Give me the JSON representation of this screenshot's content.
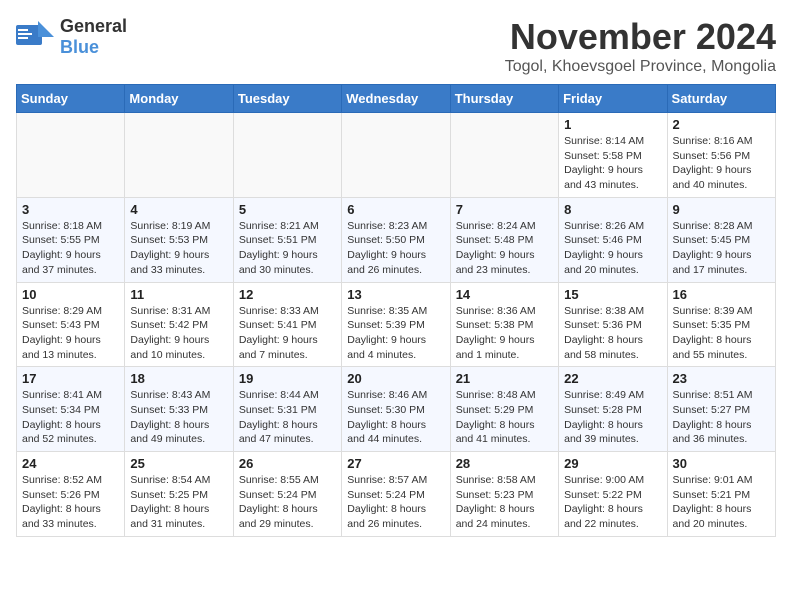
{
  "header": {
    "logo_general": "General",
    "logo_blue": "Blue",
    "month_title": "November 2024",
    "subtitle": "Togol, Khoevsgoel Province, Mongolia"
  },
  "weekdays": [
    "Sunday",
    "Monday",
    "Tuesday",
    "Wednesday",
    "Thursday",
    "Friday",
    "Saturday"
  ],
  "weeks": [
    [
      {
        "day": "",
        "info": ""
      },
      {
        "day": "",
        "info": ""
      },
      {
        "day": "",
        "info": ""
      },
      {
        "day": "",
        "info": ""
      },
      {
        "day": "",
        "info": ""
      },
      {
        "day": "1",
        "info": "Sunrise: 8:14 AM\nSunset: 5:58 PM\nDaylight: 9 hours\nand 43 minutes."
      },
      {
        "day": "2",
        "info": "Sunrise: 8:16 AM\nSunset: 5:56 PM\nDaylight: 9 hours\nand 40 minutes."
      }
    ],
    [
      {
        "day": "3",
        "info": "Sunrise: 8:18 AM\nSunset: 5:55 PM\nDaylight: 9 hours\nand 37 minutes."
      },
      {
        "day": "4",
        "info": "Sunrise: 8:19 AM\nSunset: 5:53 PM\nDaylight: 9 hours\nand 33 minutes."
      },
      {
        "day": "5",
        "info": "Sunrise: 8:21 AM\nSunset: 5:51 PM\nDaylight: 9 hours\nand 30 minutes."
      },
      {
        "day": "6",
        "info": "Sunrise: 8:23 AM\nSunset: 5:50 PM\nDaylight: 9 hours\nand 26 minutes."
      },
      {
        "day": "7",
        "info": "Sunrise: 8:24 AM\nSunset: 5:48 PM\nDaylight: 9 hours\nand 23 minutes."
      },
      {
        "day": "8",
        "info": "Sunrise: 8:26 AM\nSunset: 5:46 PM\nDaylight: 9 hours\nand 20 minutes."
      },
      {
        "day": "9",
        "info": "Sunrise: 8:28 AM\nSunset: 5:45 PM\nDaylight: 9 hours\nand 17 minutes."
      }
    ],
    [
      {
        "day": "10",
        "info": "Sunrise: 8:29 AM\nSunset: 5:43 PM\nDaylight: 9 hours\nand 13 minutes."
      },
      {
        "day": "11",
        "info": "Sunrise: 8:31 AM\nSunset: 5:42 PM\nDaylight: 9 hours\nand 10 minutes."
      },
      {
        "day": "12",
        "info": "Sunrise: 8:33 AM\nSunset: 5:41 PM\nDaylight: 9 hours\nand 7 minutes."
      },
      {
        "day": "13",
        "info": "Sunrise: 8:35 AM\nSunset: 5:39 PM\nDaylight: 9 hours\nand 4 minutes."
      },
      {
        "day": "14",
        "info": "Sunrise: 8:36 AM\nSunset: 5:38 PM\nDaylight: 9 hours\nand 1 minute."
      },
      {
        "day": "15",
        "info": "Sunrise: 8:38 AM\nSunset: 5:36 PM\nDaylight: 8 hours\nand 58 minutes."
      },
      {
        "day": "16",
        "info": "Sunrise: 8:39 AM\nSunset: 5:35 PM\nDaylight: 8 hours\nand 55 minutes."
      }
    ],
    [
      {
        "day": "17",
        "info": "Sunrise: 8:41 AM\nSunset: 5:34 PM\nDaylight: 8 hours\nand 52 minutes."
      },
      {
        "day": "18",
        "info": "Sunrise: 8:43 AM\nSunset: 5:33 PM\nDaylight: 8 hours\nand 49 minutes."
      },
      {
        "day": "19",
        "info": "Sunrise: 8:44 AM\nSunset: 5:31 PM\nDaylight: 8 hours\nand 47 minutes."
      },
      {
        "day": "20",
        "info": "Sunrise: 8:46 AM\nSunset: 5:30 PM\nDaylight: 8 hours\nand 44 minutes."
      },
      {
        "day": "21",
        "info": "Sunrise: 8:48 AM\nSunset: 5:29 PM\nDaylight: 8 hours\nand 41 minutes."
      },
      {
        "day": "22",
        "info": "Sunrise: 8:49 AM\nSunset: 5:28 PM\nDaylight: 8 hours\nand 39 minutes."
      },
      {
        "day": "23",
        "info": "Sunrise: 8:51 AM\nSunset: 5:27 PM\nDaylight: 8 hours\nand 36 minutes."
      }
    ],
    [
      {
        "day": "24",
        "info": "Sunrise: 8:52 AM\nSunset: 5:26 PM\nDaylight: 8 hours\nand 33 minutes."
      },
      {
        "day": "25",
        "info": "Sunrise: 8:54 AM\nSunset: 5:25 PM\nDaylight: 8 hours\nand 31 minutes."
      },
      {
        "day": "26",
        "info": "Sunrise: 8:55 AM\nSunset: 5:24 PM\nDaylight: 8 hours\nand 29 minutes."
      },
      {
        "day": "27",
        "info": "Sunrise: 8:57 AM\nSunset: 5:24 PM\nDaylight: 8 hours\nand 26 minutes."
      },
      {
        "day": "28",
        "info": "Sunrise: 8:58 AM\nSunset: 5:23 PM\nDaylight: 8 hours\nand 24 minutes."
      },
      {
        "day": "29",
        "info": "Sunrise: 9:00 AM\nSunset: 5:22 PM\nDaylight: 8 hours\nand 22 minutes."
      },
      {
        "day": "30",
        "info": "Sunrise: 9:01 AM\nSunset: 5:21 PM\nDaylight: 8 hours\nand 20 minutes."
      }
    ]
  ]
}
